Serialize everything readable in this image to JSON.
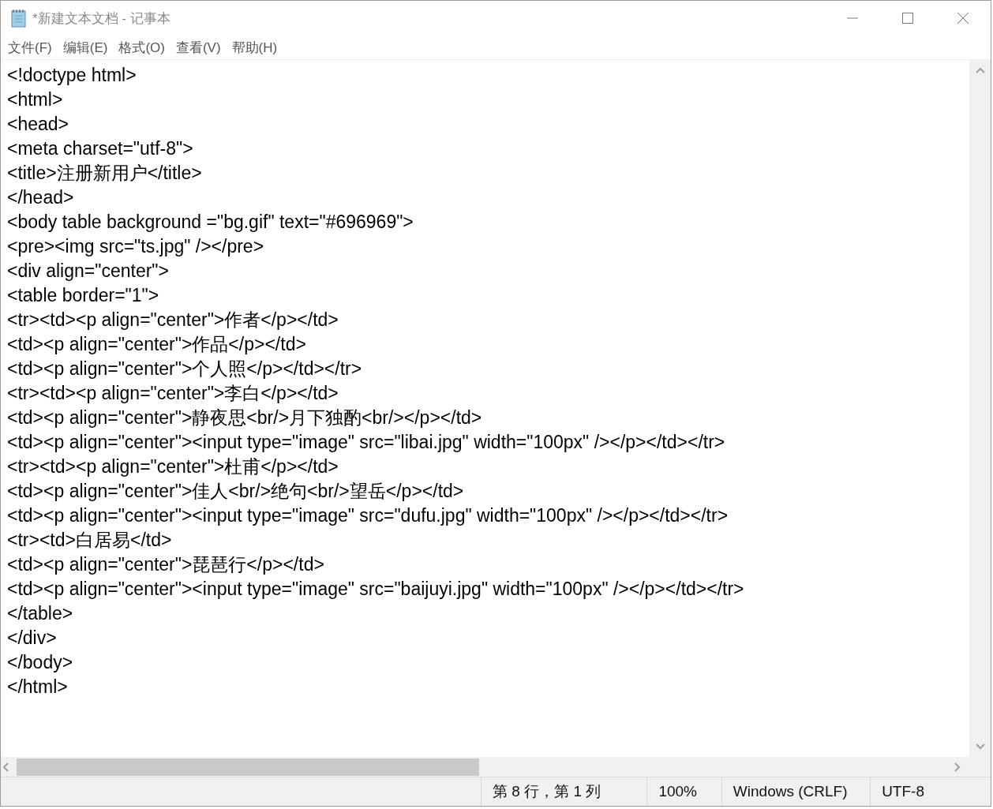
{
  "window": {
    "title": "*新建文本文档 - 记事本"
  },
  "menu": [
    "文件(F)",
    "编辑(E)",
    "格式(O)",
    "查看(V)",
    "帮助(H)"
  ],
  "editor": {
    "lines": [
      "<!doctype html>",
      "<html>",
      "<head>",
      "<meta charset=\"utf-8\">",
      "<title>注册新用户</title>",
      "</head>",
      "<body table background =\"bg.gif\" text=\"#696969\">",
      "<pre><img src=\"ts.jpg\" /></pre>",
      "<div align=\"center\">",
      "<table border=\"1\">",
      "<tr><td><p align=\"center\">作者</p></td>",
      "<td><p align=\"center\">作品</p></td>",
      "<td><p align=\"center\">个人照</p></td></tr>",
      "<tr><td><p align=\"center\">李白</p></td>",
      "<td><p align=\"center\">静夜思<br/>月下独酌<br/></p></td>",
      "<td><p align=\"center\"><input type=\"image\" src=\"libai.jpg\" width=\"100px\" /></p></td></tr>",
      "<tr><td><p align=\"center\">杜甫</p></td>",
      "<td><p align=\"center\">佳人<br/>绝句<br/>望岳</p></td>",
      "<td><p align=\"center\"><input type=\"image\" src=\"dufu.jpg\" width=\"100px\" /></p></td></tr>",
      "<tr><td>白居易</td>",
      "<td><p align=\"center\">琵琶行</p></td>",
      "<td><p align=\"center\"><input type=\"image\" src=\"baijuyi.jpg\" width=\"100px\" /></p></td></tr>",
      "</table>",
      "</div>",
      "</body>",
      "</html>"
    ]
  },
  "status_bar": {
    "position": "第 8 行，第 1 列",
    "zoom": "100%",
    "line_ending": "Windows (CRLF)",
    "encoding": "UTF-8"
  }
}
